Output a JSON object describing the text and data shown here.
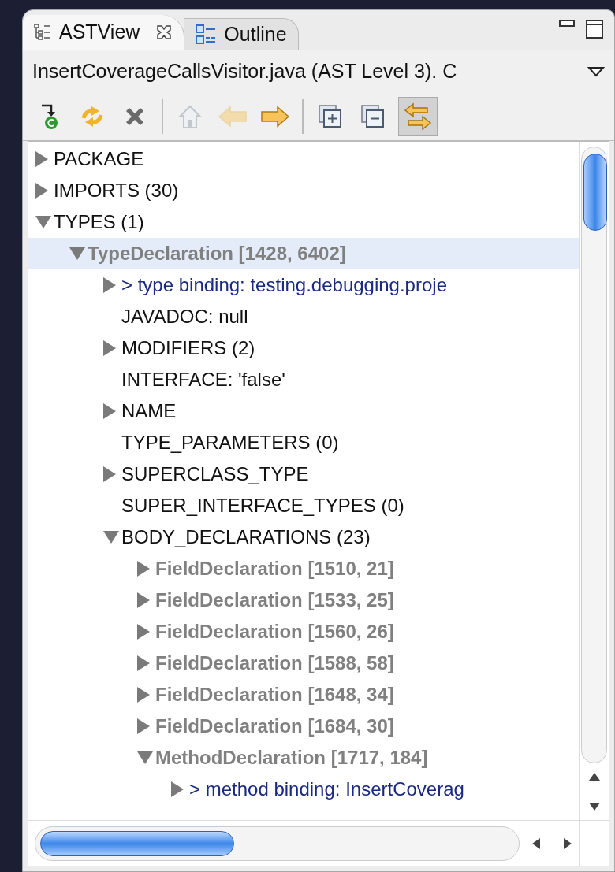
{
  "tabs": [
    {
      "label": "ASTView",
      "selected": true
    },
    {
      "label": "Outline",
      "selected": false
    }
  ],
  "view_title": "InsertCoverageCallsVisitor.java (AST Level 3).  C",
  "toolbar": [
    {
      "kind": "button",
      "disabled": false,
      "pressed": false
    },
    {
      "kind": "button",
      "disabled": false,
      "pressed": false
    },
    {
      "kind": "button",
      "disabled": false,
      "pressed": false
    },
    {
      "kind": "separator"
    },
    {
      "kind": "button",
      "disabled": true,
      "pressed": false
    },
    {
      "kind": "button",
      "disabled": true,
      "pressed": false
    },
    {
      "kind": "button",
      "disabled": false,
      "pressed": false
    },
    {
      "kind": "separator"
    },
    {
      "kind": "button",
      "disabled": false,
      "pressed": false
    },
    {
      "kind": "button",
      "disabled": false,
      "pressed": false
    },
    {
      "kind": "button",
      "disabled": false,
      "pressed": true
    }
  ],
  "tree": [
    {
      "label": "PACKAGE",
      "kind": "property",
      "expanded": false,
      "selected": false
    },
    {
      "label": "IMPORTS (30)",
      "kind": "property",
      "expanded": false,
      "selected": false
    },
    {
      "label": "TYPES (1)",
      "kind": "property",
      "expanded": true,
      "selected": false,
      "children": [
        {
          "label": "TypeDeclaration [1428, 6402]",
          "kind": "declaration",
          "expanded": true,
          "selected": true,
          "children": [
            {
              "label": "> type binding: testing.debugging.proje",
              "kind": "binding",
              "expanded": false,
              "selected": false
            },
            {
              "label": "JAVADOC: null",
              "kind": "leaf",
              "selected": false
            },
            {
              "label": "MODIFIERS (2)",
              "kind": "property",
              "expanded": false,
              "selected": false
            },
            {
              "label": "INTERFACE: 'false'",
              "kind": "leaf",
              "selected": false
            },
            {
              "label": "NAME",
              "kind": "property",
              "expanded": false,
              "selected": false
            },
            {
              "label": "TYPE_PARAMETERS (0)",
              "kind": "leaf",
              "selected": false
            },
            {
              "label": "SUPERCLASS_TYPE",
              "kind": "property",
              "expanded": false,
              "selected": false
            },
            {
              "label": "SUPER_INTERFACE_TYPES (0)",
              "kind": "leaf",
              "selected": false
            },
            {
              "label": "BODY_DECLARATIONS (23)",
              "kind": "property",
              "expanded": true,
              "selected": false,
              "children": [
                {
                  "label": "FieldDeclaration [1510, 21]",
                  "kind": "declaration",
                  "expanded": false,
                  "selected": false
                },
                {
                  "label": "FieldDeclaration [1533, 25]",
                  "kind": "declaration",
                  "expanded": false,
                  "selected": false
                },
                {
                  "label": "FieldDeclaration [1560, 26]",
                  "kind": "declaration",
                  "expanded": false,
                  "selected": false
                },
                {
                  "label": "FieldDeclaration [1588, 58]",
                  "kind": "declaration",
                  "expanded": false,
                  "selected": false
                },
                {
                  "label": "FieldDeclaration [1648, 34]",
                  "kind": "declaration",
                  "expanded": false,
                  "selected": false
                },
                {
                  "label": "FieldDeclaration [1684, 30]",
                  "kind": "declaration",
                  "expanded": false,
                  "selected": false
                },
                {
                  "label": "MethodDeclaration [1717, 184]",
                  "kind": "declaration",
                  "expanded": true,
                  "selected": false,
                  "children": [
                    {
                      "label": "> method binding: InsertCoverag",
                      "kind": "binding",
                      "expanded": false,
                      "selected": false
                    }
                  ]
                }
              ]
            }
          ]
        }
      ]
    }
  ]
}
